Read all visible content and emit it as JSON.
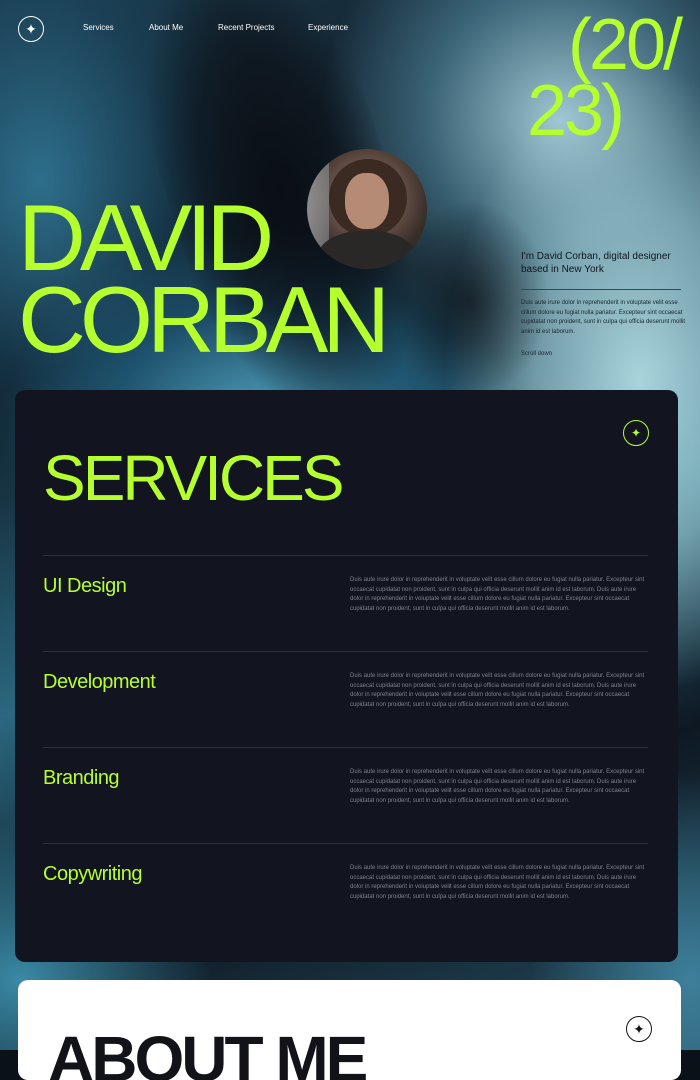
{
  "nav": {
    "logo_icon": "sparkle-icon",
    "links": [
      "Services",
      "About Me",
      "Recent Projects",
      "Experience"
    ]
  },
  "hero": {
    "year_line1": "(20/",
    "year_line2": "23)",
    "name_line1": "DAVID",
    "name_line2": "CORBAN",
    "intro_title": "I'm David Corban, digital designer based in New York",
    "intro_body": "Duis aute irure dolor in reprehenderit in voluptate velit esse cillum dolore eu fugiat nulla pariatur. Excepteur sint occaecat cupidatat non proident, sunt in culpa qui officia deserunt mollit anim id est laborum.",
    "scroll_label": "Scroll down"
  },
  "services": {
    "title": "SERVICES",
    "icon": "sparkle-icon",
    "items": [
      {
        "name": "UI Design",
        "desc": "Duis aute irure dolor in reprehenderit in voluptate velit esse cillum dolore eu fugiat nulla pariatur. Excepteur sint occaecat cupidatat non proident, sunt in culpa qui officia deserunt mollit anim id est laborum. Duis aute irure dolor in reprehenderit in voluptate velit esse cillum dolore eu fugiat nulla pariatur. Excepteur sint occaecat cupidatat non proident, sunt in culpa qui officia deserunt mollit anim id est laborum."
      },
      {
        "name": "Development",
        "desc": "Duis aute irure dolor in reprehenderit in voluptate velit esse cillum dolore eu fugiat nulla pariatur. Excepteur sint occaecat cupidatat non proident, sunt in culpa qui officia deserunt mollit anim id est laborum. Duis aute irure dolor in reprehenderit in voluptate velit esse cillum dolore eu fugiat nulla pariatur. Excepteur sint occaecat cupidatat non proident, sunt in culpa qui officia deserunt mollit anim id est laborum."
      },
      {
        "name": "Branding",
        "desc": "Duis aute irure dolor in reprehenderit in voluptate velit esse cillum dolore eu fugiat nulla pariatur. Excepteur sint occaecat cupidatat non proident, sunt in culpa qui officia deserunt mollit anim id est laborum. Duis aute irure dolor in reprehenderit in voluptate velit esse cillum dolore eu fugiat nulla pariatur. Excepteur sint occaecat cupidatat non proident, sunt in culpa qui officia deserunt mollit anim id est laborum."
      },
      {
        "name": "Copywriting",
        "desc": "Duis aute irure dolor in reprehenderit in voluptate velit esse cillum dolore eu fugiat nulla pariatur. Excepteur sint occaecat cupidatat non proident, sunt in culpa qui officia deserunt mollit anim id est laborum. Duis aute irure dolor in reprehenderit in voluptate velit esse cillum dolore eu fugiat nulla pariatur. Excepteur sint occaecat cupidatat non proident, sunt in culpa qui officia deserunt mollit anim id est laborum."
      }
    ]
  },
  "about": {
    "title": "ABOUT ME",
    "icon": "sparkle-icon"
  },
  "colors": {
    "accent": "#b6ff2e",
    "panel": "#121520",
    "card": "#ffffff"
  }
}
